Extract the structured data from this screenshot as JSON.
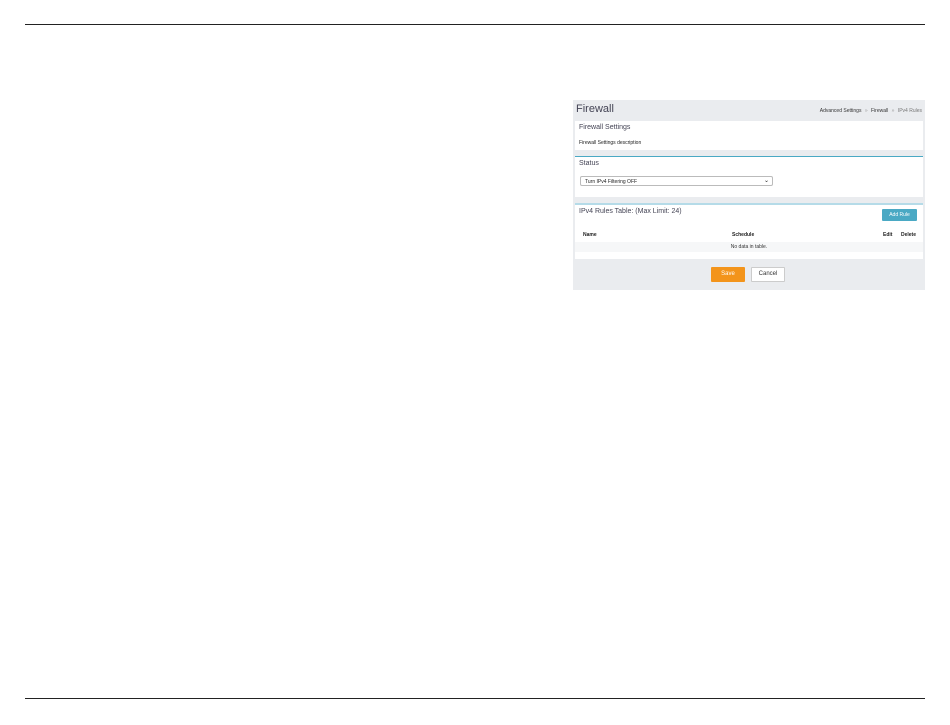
{
  "page": {
    "title": "Firewall",
    "breadcrumb": [
      "Advanced Settings",
      "Firewall",
      "IPv4 Rules"
    ],
    "breadcrumb_separator": "»"
  },
  "firewall_settings": {
    "title": "Firewall Settings",
    "description": "Firewall Settings description"
  },
  "status": {
    "title": "Status",
    "selected": "Turn IPv4 Filtering OFF"
  },
  "rules_table": {
    "title": "IPv4 Rules Table: (Max Limit: 24)",
    "add_label": "Add Rule",
    "columns": [
      "Name",
      "Schedule",
      "Edit",
      "Delete"
    ],
    "empty_text": "No data in table."
  },
  "actions": {
    "save": "Save",
    "cancel": "Cancel"
  },
  "colors": {
    "accent": "#4aa9c4",
    "save": "#f3941b",
    "panel_bg": "#eaecef"
  }
}
